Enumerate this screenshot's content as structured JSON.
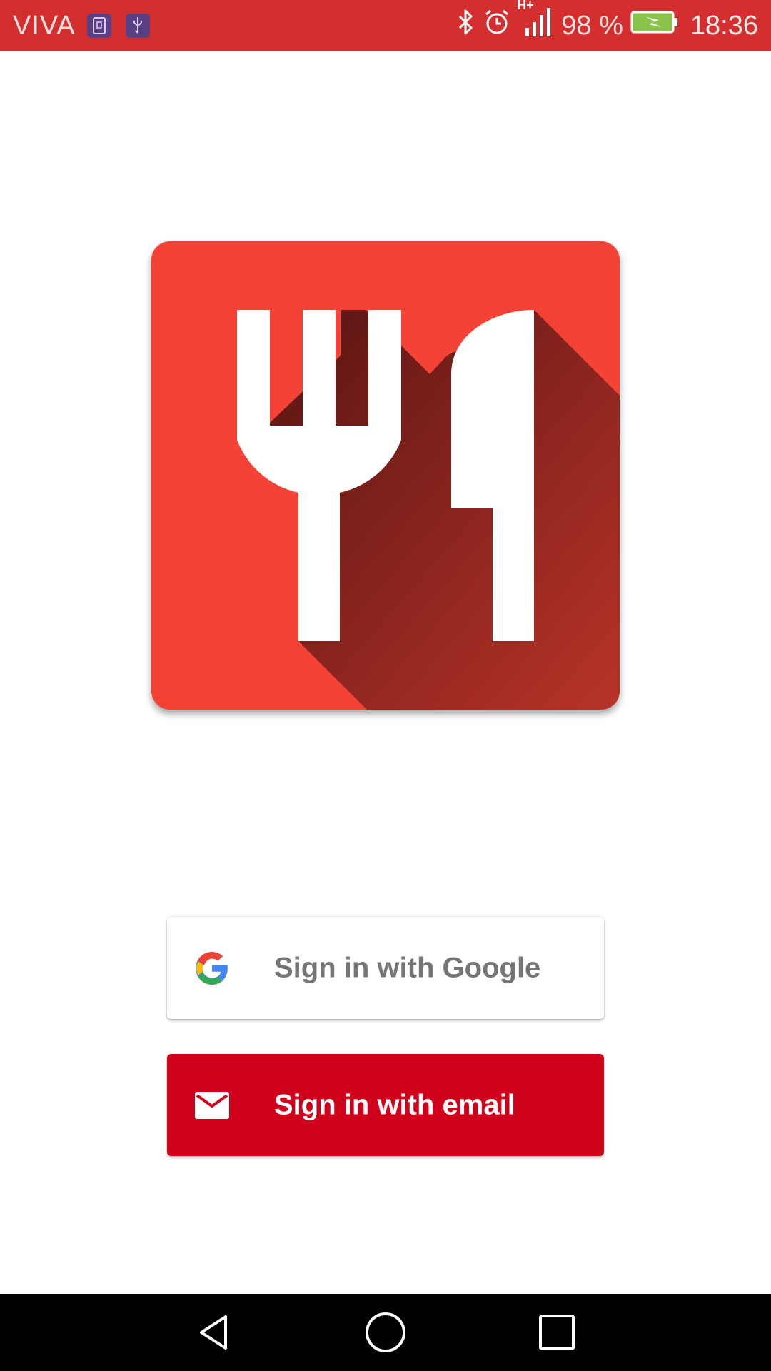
{
  "status_bar": {
    "carrier": "VIVA",
    "battery_percent": "98 %",
    "time": "18:36",
    "network_label": "H+",
    "icons": [
      "sim-card-icon",
      "usb-icon",
      "bluetooth-icon",
      "alarm-icon",
      "signal-icon",
      "battery-charging-icon"
    ]
  },
  "app_logo": {
    "icon": "fork-knife-icon",
    "colors": {
      "background": "#f44336",
      "shadow": "#8b2420",
      "glyph": "#ffffff"
    }
  },
  "google_button": {
    "label": "Sign in with Google",
    "icon": "google-g-icon",
    "colors": {
      "background": "#ffffff",
      "text": "#757575"
    }
  },
  "email_button": {
    "label": "Sign in with email",
    "icon": "mail-icon",
    "colors": {
      "background": "#d0021b",
      "text": "#ffffff"
    }
  },
  "nav_bar": {
    "icons": [
      "back-icon",
      "home-icon",
      "recents-icon"
    ]
  }
}
